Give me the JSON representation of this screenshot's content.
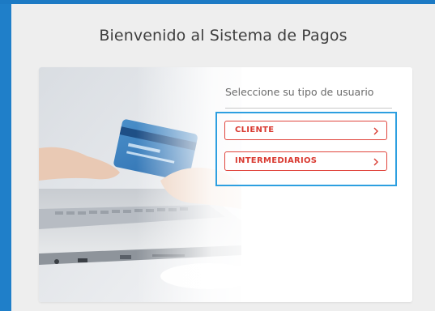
{
  "page": {
    "title": "Bienvenido al Sistema de Pagos"
  },
  "card": {
    "prompt": "Seleccione su tipo de usuario",
    "options": [
      {
        "label": "CLIENTE",
        "icon": "chevron-right-icon"
      },
      {
        "label": "INTERMEDIARIOS",
        "icon": "chevron-right-icon"
      }
    ]
  },
  "colors": {
    "frame_blue": "#1f7fc9",
    "selection_outline": "#2d9fe0",
    "button_red": "#d93a31"
  }
}
